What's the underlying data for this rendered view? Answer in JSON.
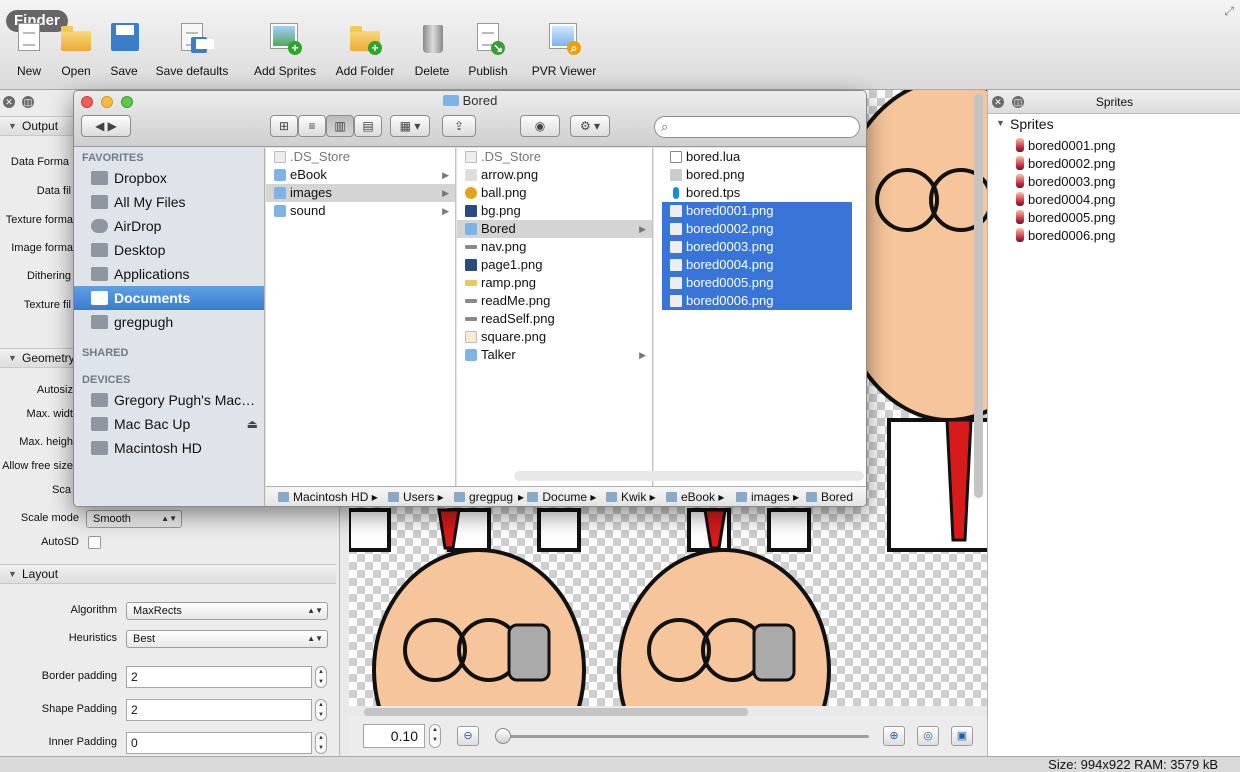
{
  "toolbar": {
    "badge": "Finder",
    "buttons": [
      {
        "label": "New",
        "icon": "new-file-icon"
      },
      {
        "label": "Open",
        "icon": "open-folder-icon"
      },
      {
        "label": "Save",
        "icon": "save-icon"
      },
      {
        "label": "Save defaults",
        "icon": "save-defaults-icon"
      },
      {
        "label": "Add Sprites",
        "icon": "add-sprites-icon"
      },
      {
        "label": "Add Folder",
        "icon": "add-folder-icon"
      },
      {
        "label": "Delete",
        "icon": "trash-icon"
      },
      {
        "label": "Publish",
        "icon": "publish-icon"
      },
      {
        "label": "PVR Viewer",
        "icon": "pvr-viewer-icon"
      }
    ]
  },
  "left": {
    "output": {
      "title": "Output",
      "labels": [
        "Data Forma",
        "Data fil",
        "Texture forma",
        "Image forma",
        "Dithering",
        "Texture fil"
      ]
    },
    "geometry": {
      "title": "Geometry",
      "labels": [
        "Autosiz",
        "Max. widt",
        "Max. heigh",
        "Allow free size",
        "Sca"
      ],
      "scale_mode_label": "Scale mode",
      "scale_mode_value": "Smooth",
      "autosd_label": "AutoSD"
    },
    "layout": {
      "title": "Layout",
      "algorithm_label": "Algorithm",
      "algorithm_value": "MaxRects",
      "heuristics_label": "Heuristics",
      "heuristics_value": "Best",
      "border_padding_label": "Border padding",
      "border_padding": "2",
      "shape_padding_label": "Shape Padding",
      "shape_padding": "2",
      "inner_padding_label": "Inner Padding",
      "inner_padding": "0"
    }
  },
  "zoom": {
    "value": "0.10",
    "level": 0.01
  },
  "right": {
    "title": "Sprites",
    "section": "Sprites",
    "sprites": [
      "bored0001.png",
      "bored0002.png",
      "bored0003.png",
      "bored0004.png",
      "bored0005.png",
      "bored0006.png"
    ]
  },
  "status": {
    "size": "Size: 994x922 RAM: 3579 kB"
  },
  "finder": {
    "title": "Bored",
    "sidebar": {
      "favorites_title": "FAVORITES",
      "favorites": [
        "Dropbox",
        "All My Files",
        "AirDrop",
        "Desktop",
        "Applications",
        "Documents",
        "gregpugh"
      ],
      "shared_title": "SHARED",
      "devices_title": "DEVICES",
      "devices": [
        "Gregory Pugh's Mac…",
        "Mac Bac Up",
        "Macintosh HD"
      ]
    },
    "col1": [
      ".DS_Store",
      "eBook",
      "images",
      "sound"
    ],
    "col2": [
      ".DS_Store",
      "arrow.png",
      "ball.png",
      "bg.png",
      "Bored",
      "nav.png",
      "page1.png",
      "ramp.png",
      "readMe.png",
      "readSelf.png",
      "square.png",
      "Talker"
    ],
    "col3": [
      "bored.lua",
      "bored.png",
      "bored.tps",
      "bored0001.png",
      "bored0002.png",
      "bored0003.png",
      "bored0004.png",
      "bored0005.png",
      "bored0006.png"
    ],
    "path": [
      "Macintosh HD",
      "Users",
      "gregpug",
      "Docume",
      "Kwik",
      "eBook",
      "images",
      "Bored"
    ]
  }
}
